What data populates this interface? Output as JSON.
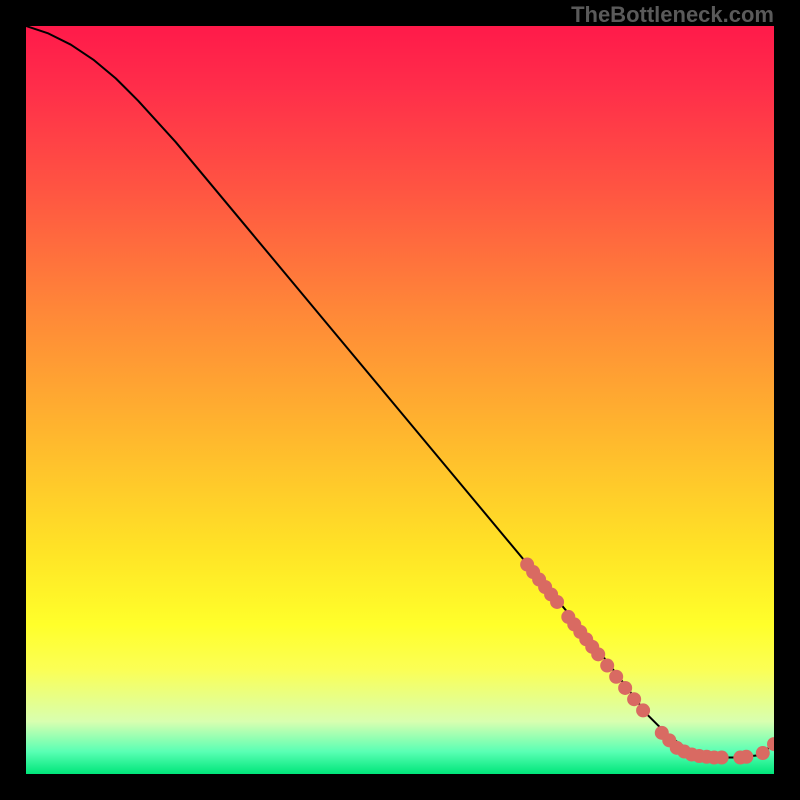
{
  "watermark": "TheBottleneck.com",
  "chart_data": {
    "type": "line",
    "title": "",
    "xlabel": "",
    "ylabel": "",
    "xlim": [
      0,
      100
    ],
    "ylim": [
      0,
      100
    ],
    "series": [
      {
        "name": "curve",
        "x": [
          0,
          3,
          6,
          9,
          12,
          15,
          20,
          30,
          40,
          50,
          60,
          70,
          75,
          80,
          83,
          86,
          89,
          92,
          95,
          98,
          100
        ],
        "y": [
          100,
          99,
          97.5,
          95.5,
          93,
          90,
          84.5,
          72.5,
          60.5,
          48.5,
          36.5,
          24.5,
          18.5,
          12,
          8,
          5,
          3,
          2.2,
          2.2,
          2.5,
          4
        ]
      }
    ],
    "scatter_points": {
      "name": "dots",
      "color": "#d96a62",
      "points": [
        {
          "x": 67.0,
          "y": 28.0
        },
        {
          "x": 67.8,
          "y": 27.0
        },
        {
          "x": 68.6,
          "y": 26.0
        },
        {
          "x": 69.4,
          "y": 25.0
        },
        {
          "x": 70.2,
          "y": 24.0
        },
        {
          "x": 71.0,
          "y": 23.0
        },
        {
          "x": 72.5,
          "y": 21.0
        },
        {
          "x": 73.3,
          "y": 20.0
        },
        {
          "x": 74.1,
          "y": 19.0
        },
        {
          "x": 74.9,
          "y": 18.0
        },
        {
          "x": 75.7,
          "y": 17.0
        },
        {
          "x": 76.5,
          "y": 16.0
        },
        {
          "x": 77.7,
          "y": 14.5
        },
        {
          "x": 78.9,
          "y": 13.0
        },
        {
          "x": 80.1,
          "y": 11.5
        },
        {
          "x": 81.3,
          "y": 10.0
        },
        {
          "x": 82.5,
          "y": 8.5
        },
        {
          "x": 85.0,
          "y": 5.5
        },
        {
          "x": 86.0,
          "y": 4.5
        },
        {
          "x": 87.0,
          "y": 3.5
        },
        {
          "x": 88.0,
          "y": 3.0
        },
        {
          "x": 89.0,
          "y": 2.6
        },
        {
          "x": 90.0,
          "y": 2.4
        },
        {
          "x": 91.0,
          "y": 2.3
        },
        {
          "x": 92.0,
          "y": 2.2
        },
        {
          "x": 93.0,
          "y": 2.2
        },
        {
          "x": 95.5,
          "y": 2.2
        },
        {
          "x": 96.3,
          "y": 2.3
        },
        {
          "x": 98.5,
          "y": 2.8
        },
        {
          "x": 100.0,
          "y": 4.0
        }
      ]
    }
  }
}
